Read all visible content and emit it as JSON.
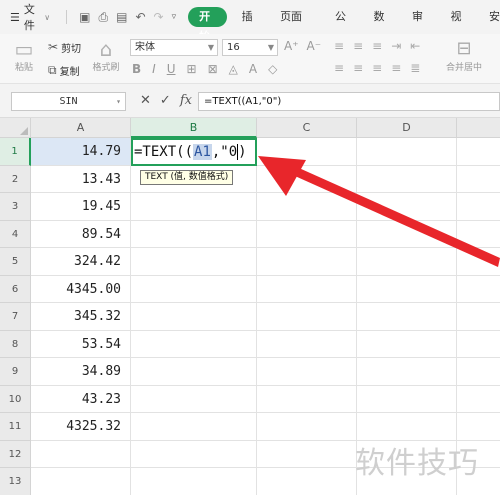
{
  "menubar": {
    "file_label": "文件",
    "tabs": [
      "开始",
      "插入",
      "页面布局",
      "公式",
      "数据",
      "审阅",
      "视图",
      "安"
    ],
    "active_tab": "开始"
  },
  "ribbon": {
    "paste_label": "粘贴",
    "cut_label": "剪切",
    "copy_label": "复制",
    "format_painter_label": "格式刷",
    "font_name": "宋体",
    "font_size": "16",
    "merge_label": "合并居中"
  },
  "formula_bar": {
    "name_box": "SIN",
    "formula": "=TEXT((A1,\"0\")"
  },
  "grid": {
    "columns": [
      "A",
      "B",
      "C",
      "D"
    ],
    "rows": [
      "1",
      "2",
      "3",
      "4",
      "5",
      "6",
      "7",
      "8",
      "9",
      "10",
      "11",
      "12",
      "13"
    ],
    "col_a_values": [
      "14.79",
      "13.43",
      "19.45",
      "89.54",
      "324.42",
      "4345.00",
      "345.32",
      "53.54",
      "34.89",
      "43.23",
      "4325.32",
      "",
      ""
    ],
    "edit_prefix": "=TEXT((",
    "edit_ref": "A1",
    "edit_suffix_a": ",\"0",
    "edit_suffix_b": ")",
    "tooltip": "TEXT (值, 数值格式)"
  },
  "watermark": "软件技巧",
  "colors": {
    "accent_green": "#23a05a",
    "arrow_red": "#e8262b",
    "ref_highlight": "#c7d6ec"
  }
}
